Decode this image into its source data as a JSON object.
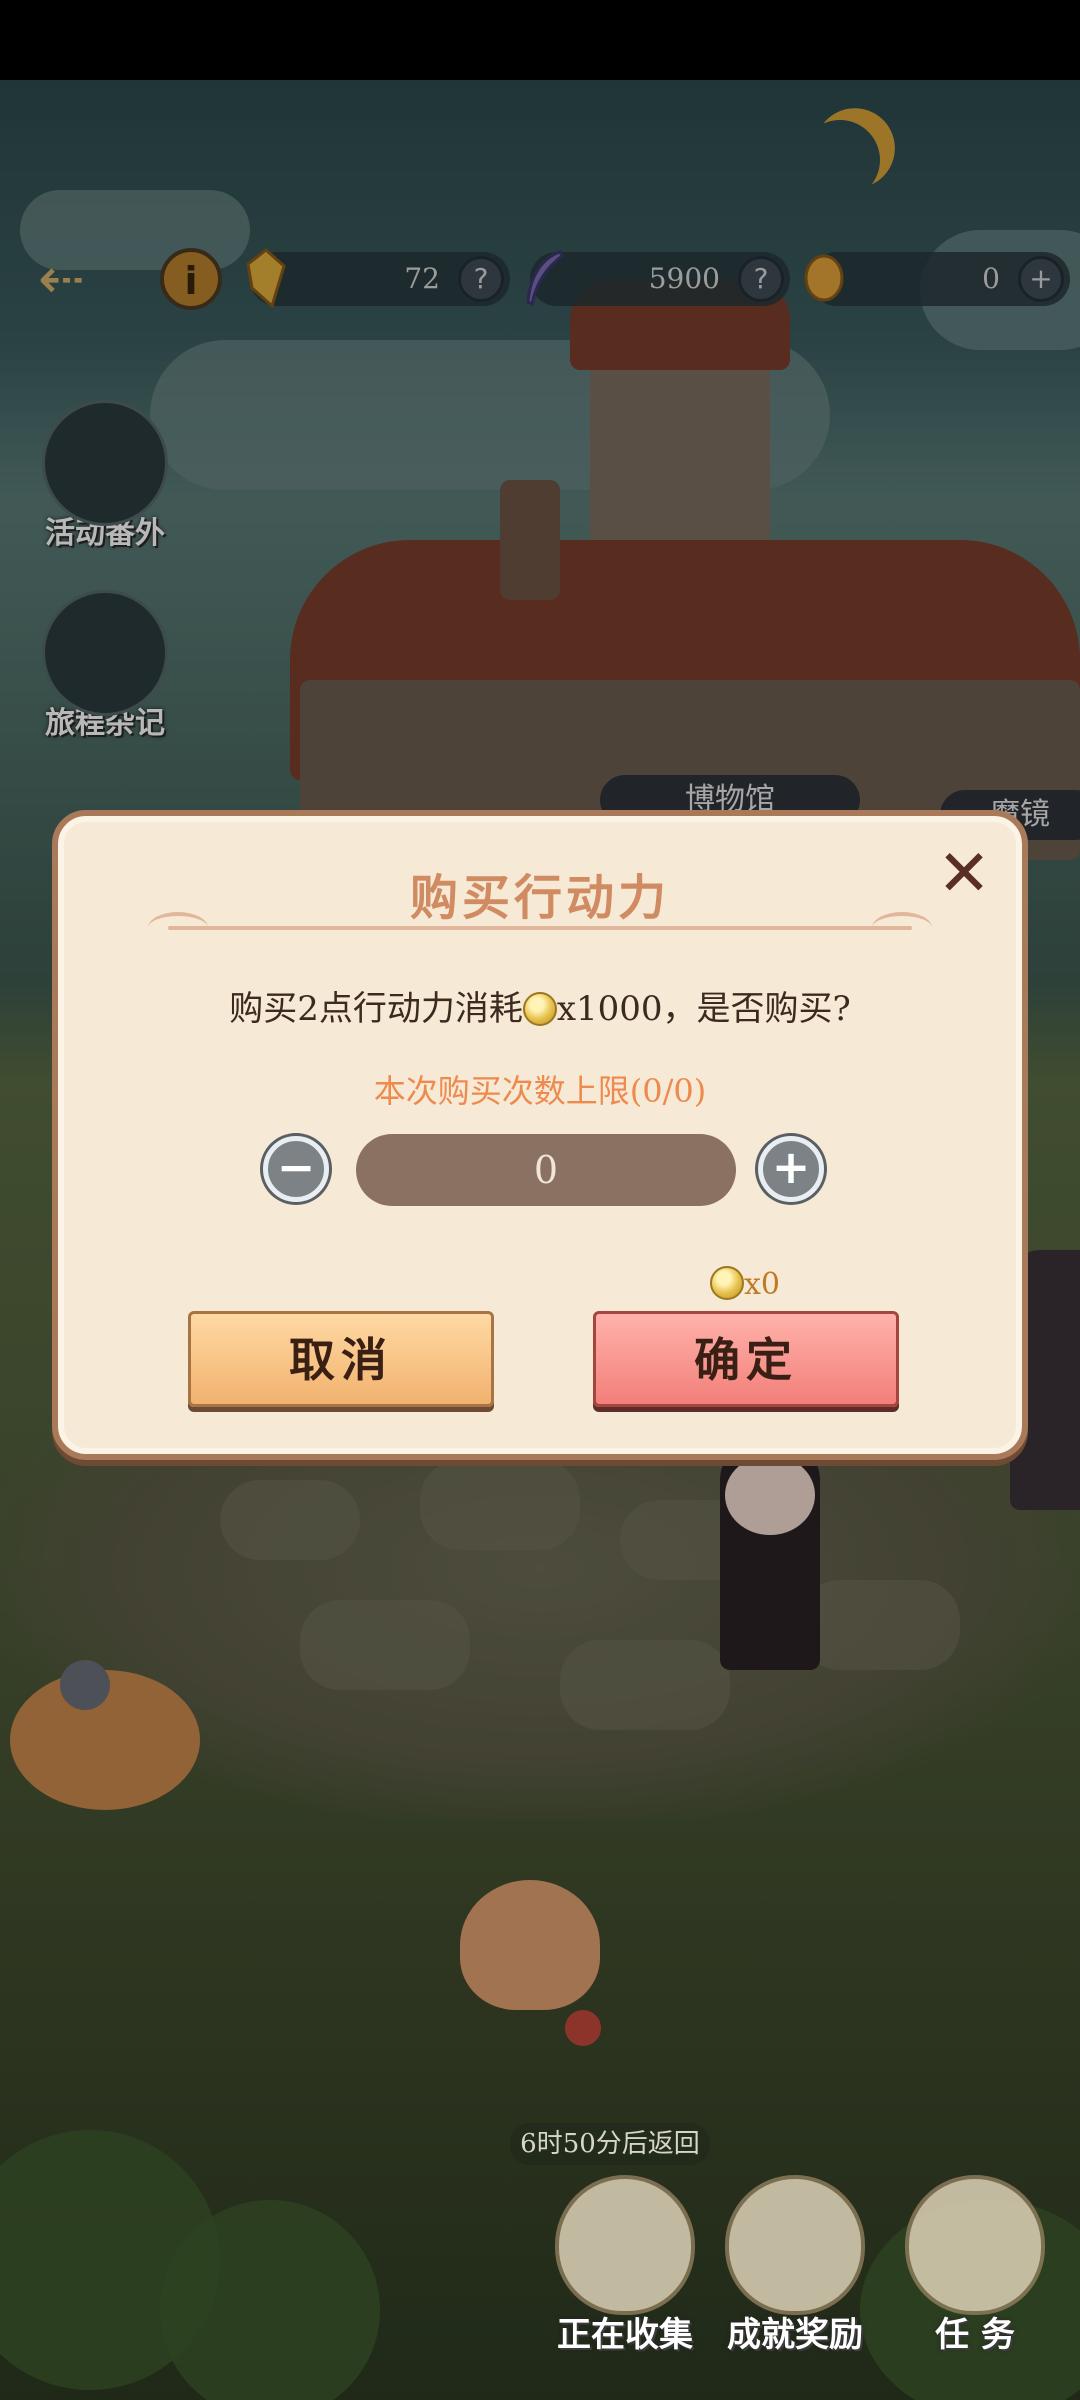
{
  "topbar": {
    "resources": [
      {
        "icon": "gem-icon",
        "value": "72"
      },
      {
        "icon": "feather-icon",
        "value": "5900"
      },
      {
        "icon": "bread-icon",
        "value": "0"
      }
    ]
  },
  "side_menu": [
    {
      "label": "活动番外",
      "icon": "film-moon-icon"
    },
    {
      "label": "旅程杂记",
      "icon": "book-icon"
    }
  ],
  "buildings": [
    "博物馆",
    "魔镜"
  ],
  "dialog": {
    "title": "购买行动力",
    "prompt_before": "购买2点行动力消耗",
    "prompt_after": "x1000，是否购买?",
    "limit": "本次购买次数上限(0/0)",
    "quantity": "0",
    "cost": "x0",
    "cancel_label": "取消",
    "confirm_label": "确定"
  },
  "timer": "6时50分后返回",
  "bottom_nav": [
    {
      "label": "正在收集",
      "icon": "feather-quill-icon"
    },
    {
      "label": "成就奖励",
      "icon": "castle-seal-icon"
    },
    {
      "label": "任 务",
      "icon": "quest-book-icon"
    }
  ]
}
